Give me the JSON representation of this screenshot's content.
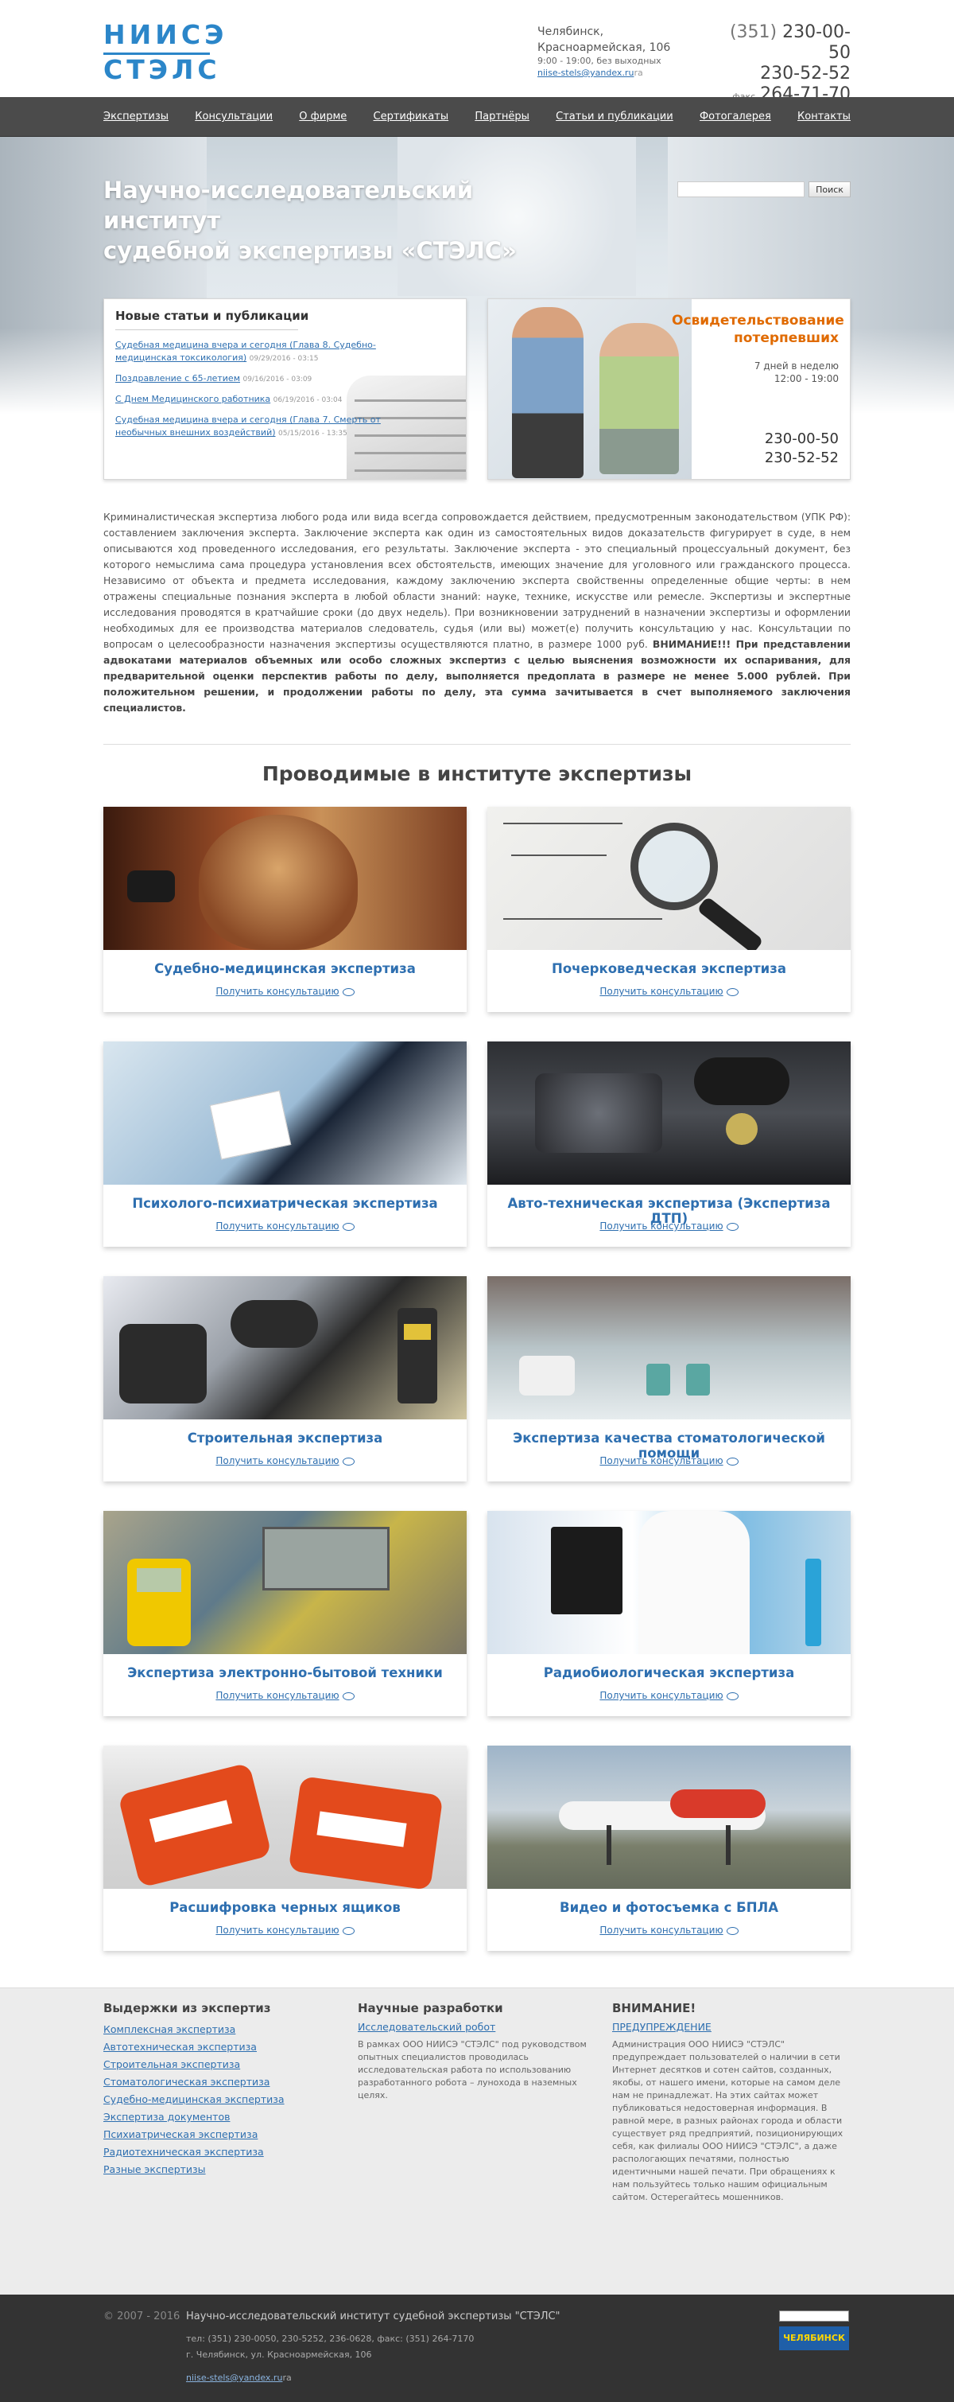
{
  "header": {
    "logo_line1": "НИИСЭ",
    "logo_line2": "СТЭЛС",
    "city": "Челябинск,",
    "street": "Красноармейская, 106",
    "hours": "9:00 - 19:00, без выходных",
    "email": "niise-stels@yandex.ru",
    "phone_code": "(351)",
    "phone1": "230-00-50",
    "phone2": "230-52-52",
    "fax_label": "факс",
    "phone3": "264-71-70"
  },
  "nav": [
    "Экспертизы",
    "Консультации",
    "О фирме",
    "Сертификаты",
    "Партнёры",
    "Статьи и публикации",
    "Фотогалерея",
    "Контакты"
  ],
  "hero": {
    "title_line1": "Научно-исследовательский институт",
    "title_line2": "судебной экспертизы «СТЭЛС»",
    "search_button": "Поиск"
  },
  "news": {
    "heading": "Новые статьи и публикации",
    "items": [
      {
        "title": "Судебная медицина вчера и сегодня (Глава 8. Судебно-медицинская токсикология)",
        "date": "09/29/2016 - 03:15"
      },
      {
        "title": "Поздравление с 65-летием",
        "date": "09/16/2016 - 03:09"
      },
      {
        "title": "С Днем Медицинского работника",
        "date": "06/19/2016 - 03:04"
      },
      {
        "title": "Судебная медицина вчера и сегодня (Глава 7. Смерть от необычных внешних воздействий)",
        "date": "05/15/2016 - 13:35"
      }
    ]
  },
  "witness": {
    "title": "Освидетельствование потерпевших",
    "days": "7 дней в неделю",
    "time": "12:00 - 19:00",
    "phone1": "230-00-50",
    "phone2": "230-52-52"
  },
  "intro": {
    "text": "Криминалистическая экспертиза любого рода или вида всегда сопровождается действием, предусмотренным законодательством (УПК РФ): составлением заключения эксперта. Заключение эксперта как один из самостоятельных видов доказательств фигурирует в суде, в нем описываются ход проведенного исследования, его результаты. Заключение эксперта - это специальный процессуальный документ, без которого немыслима сама процедура установления всех обстоятельств, имеющих значение для уголовного или гражданского процесса. Независимо от объекта и предмета исследования, каждому заключению эксперта свойственны определенные общие черты: в нем отражены специальные познания эксперта в любой области знаний: науке, технике, искусстве или ремесле. Экспертизы и экспертные исследования проводятся в кратчайшие сроки (до двух недель). При возникновении затруднений в назначении экспертизы и оформлении необходимых для ее производства материалов следователь, судья (или вы) может(е) получить консультацию у нас. Консультации по вопросам о целесообразности назначения экспертизы осуществляются платно, в размере 1000 руб.",
    "bold": "ВНИМАНИЕ!!! При представлении адвокатами материалов объемных или особо сложных экспертиз с целью выяснения возможности их оспаривания, для предварительной оценки перспектив работы по делу, выполняется предоплата в размере не менее 5.000 рублей. При положительном решении, и продолжении работы по делу, эта сумма зачитывается в счет выполняемого заключения специалистов."
  },
  "section_title": "Проводимые в институте экспертизы",
  "consult_label": "Получить консультацию",
  "cards": [
    {
      "title": "Судебно-медицинская экспертиза"
    },
    {
      "title": "Почерковедческая экспертиза"
    },
    {
      "title": "Психолого-психиатрическая экспертиза"
    },
    {
      "title": "Авто-техническая экспертиза (Экспертиза ДТП)"
    },
    {
      "title": "Строительная экспертиза"
    },
    {
      "title": "Экспертиза качества стоматологической помощи"
    },
    {
      "title": "Экспертиза электронно-бытовой техники"
    },
    {
      "title": "Радиобиологическая экспертиза"
    },
    {
      "title": "Расшифровка черных ящиков"
    },
    {
      "title": "Видео и фотосъемка с БПЛА"
    }
  ],
  "bottom": {
    "col1_heading": "Выдержки из экспертиз",
    "col1_links": [
      "Комплексная экспертиза",
      "Автотехническая экспертиза",
      "Строительная экспертиза",
      "Стоматологическая экспертиза",
      "Судебно-медицинская экспертиза",
      "Экспертиза документов",
      "Психиатрическая экспертиза",
      "Радиотехническая экспертиза",
      "Разные экспертизы"
    ],
    "col2_heading": "Научные разработки",
    "col2_link": "Исследовательский робот",
    "col2_text": "В рамках ООО НИИСЭ \"СТЭЛС\" под руководством опытных специалистов проводилась исследовательская работа по использованию разработанного робота – лунохода в наземных целях.",
    "col3_heading": "ВНИМАНИЕ!",
    "col3_link": "ПРЕДУПРЕЖДЕНИЕ",
    "col3_text": "Администрация ООО НИИСЭ \"СТЭЛС\" предупреждает пользователей о наличии в сети Интернет десятков и сотен сайтов, созданных, якобы, от нашего имени, которые на самом деле нам не принадлежат. На этих сайтах может публиковаться недостоверная информация. В равной мере, в разных районах города и области существует ряд предприятий, позиционирующих себя, как филиалы ООО НИИСЭ \"СТЭЛС\", а даже распологающих печатями, полностью идентичными нашей печати. При обращениях к нам пользуйтесь только нашим официальным сайтом. Остерегайтесь мошенников."
  },
  "footer": {
    "copy": "© 2007 - 2016",
    "name": "Научно-исследовательский институт судебной экспертизы \"СТЭЛС\"",
    "phones": "тел: (351) 230-0050, 230-5252, 236-0628, факс: (351) 264-7170",
    "address": "г. Челябинск, ул. Красноармейская, 106",
    "email": "niise-stels@yandex.ru",
    "badge": "ЧЕЛЯБИНСК"
  }
}
